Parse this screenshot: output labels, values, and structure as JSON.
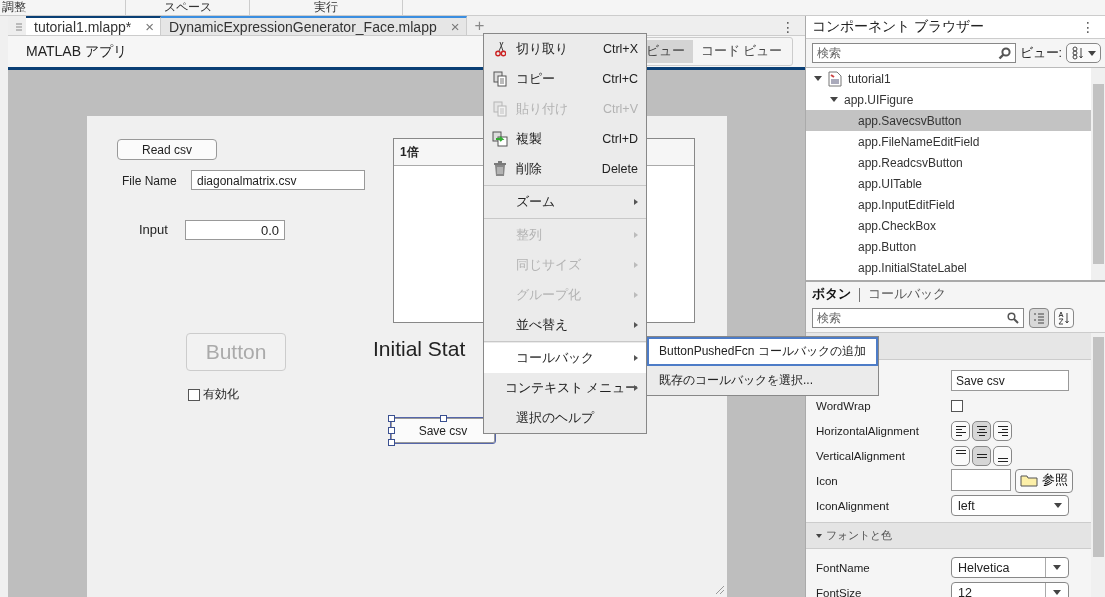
{
  "toolstrip_sections": [
    "調整",
    "スペース",
    "実行"
  ],
  "tabs": [
    {
      "label": "tutorial1.mlapp*",
      "close": "×",
      "selected": true
    },
    {
      "label": "DynamicExpressionGenerator_Face.mlapp",
      "close": "×",
      "selected": false
    }
  ],
  "new_tab": "+",
  "tab_menu": "⋮",
  "app_label": "MATLAB アプリ",
  "view_toggle": [
    {
      "label": "ビュー",
      "selected": true
    },
    {
      "label": "コード ビュー",
      "selected": false
    }
  ],
  "design": {
    "read_button": "Read csv",
    "file_label": "File Name",
    "file_value": "diagonalmatrix.csv",
    "input_label": "Input",
    "input_value": "0.0",
    "table_header": "1倍",
    "button": {
      "label": "Button",
      "disabled": true
    },
    "checkbox": {
      "label": "有効化",
      "checked": false
    },
    "state_label": "Initial Stat",
    "save_button": {
      "label": "Save csv",
      "selected": true
    }
  },
  "context_menu": [
    {
      "kind": "item",
      "label": "切り取り",
      "shortcut": "Ctrl+X",
      "disabled": false,
      "has_submenu": false,
      "highlighted": false
    },
    {
      "kind": "item",
      "label": "コピー",
      "shortcut": "Ctrl+C",
      "disabled": false,
      "has_submenu": false,
      "highlighted": false
    },
    {
      "kind": "item",
      "label": "貼り付け",
      "shortcut": "Ctrl+V",
      "disabled": true,
      "has_submenu": false,
      "highlighted": false
    },
    {
      "kind": "item",
      "label": "複製",
      "shortcut": "Ctrl+D",
      "disabled": false,
      "has_submenu": false,
      "highlighted": false
    },
    {
      "kind": "item",
      "label": "削除",
      "shortcut": "Delete",
      "disabled": false,
      "has_submenu": false,
      "highlighted": false
    },
    {
      "kind": "separator"
    },
    {
      "kind": "item",
      "label": "ズーム",
      "disabled": false,
      "has_submenu": true,
      "highlighted": false
    },
    {
      "kind": "separator"
    },
    {
      "kind": "item",
      "label": "整列",
      "disabled": true,
      "has_submenu": true,
      "highlighted": false
    },
    {
      "kind": "item",
      "label": "同じサイズ",
      "disabled": true,
      "has_submenu": true,
      "highlighted": false
    },
    {
      "kind": "item",
      "label": "グループ化",
      "disabled": true,
      "has_submenu": true,
      "highlighted": false
    },
    {
      "kind": "item",
      "label": "並べ替え",
      "disabled": false,
      "has_submenu": true,
      "highlighted": false
    },
    {
      "kind": "separator"
    },
    {
      "kind": "item",
      "label": "コールバック",
      "disabled": false,
      "has_submenu": true,
      "highlighted": true
    },
    {
      "kind": "item",
      "label": "コンテキスト メニュー",
      "disabled": false,
      "has_submenu": true,
      "highlighted": false
    },
    {
      "kind": "item",
      "label": "選択のヘルプ",
      "disabled": false,
      "has_submenu": false,
      "highlighted": false
    }
  ],
  "submenu": [
    {
      "label": "ButtonPushedFcn コールバックの追加",
      "highlighted": true
    },
    {
      "label": "既存のコールバックを選択...",
      "highlighted": false
    }
  ],
  "browser": {
    "title": "コンポーネント ブラウザー",
    "menu": "⋮",
    "search_placeholder": "検索",
    "view_label": "ビュー:",
    "tree": [
      {
        "label": "tutorial1",
        "expanded": true,
        "selected": false,
        "children": [
          {
            "label": "app.UIFigure",
            "expanded": true,
            "selected": false,
            "children": [
              {
                "label": "app.SavecsvButton",
                "selected": true
              },
              {
                "label": "app.FileNameEditField",
                "selected": false
              },
              {
                "label": "app.ReadcsvButton",
                "selected": false
              },
              {
                "label": "app.UITable",
                "selected": false
              },
              {
                "label": "app.InputEditField",
                "selected": false
              },
              {
                "label": "app.CheckBox",
                "selected": false
              },
              {
                "label": "app.Button",
                "selected": false
              },
              {
                "label": "app.InitialStateLabel",
                "selected": false
              }
            ]
          }
        ]
      }
    ]
  },
  "inspector": {
    "tabs": [
      {
        "label": "ボタン",
        "selected": true
      },
      {
        "label": "コールバック",
        "selected": false
      }
    ],
    "search_placeholder": "検索",
    "props": [
      {
        "kind": "text",
        "value": "Save csv"
      },
      {
        "kind": "checkbox",
        "name": "WordWrap",
        "checked": false
      },
      {
        "kind": "halign",
        "name": "HorizontalAlignment",
        "options": [
          {
            "selected": false
          },
          {
            "selected": true
          },
          {
            "selected": false
          }
        ]
      },
      {
        "kind": "valign",
        "name": "VerticalAlignment",
        "options": [
          {
            "selected": false
          },
          {
            "selected": true
          },
          {
            "selected": false
          }
        ]
      },
      {
        "kind": "file",
        "name": "Icon",
        "button": "参照"
      },
      {
        "kind": "dropdown",
        "name": "IconAlignment",
        "value": "left"
      },
      {
        "kind": "section",
        "label": "フォントと色",
        "expanded": true
      },
      {
        "kind": "combo",
        "name": "FontName",
        "value": "Helvetica"
      },
      {
        "kind": "combo",
        "name": "FontSize",
        "value": "12"
      }
    ]
  }
}
